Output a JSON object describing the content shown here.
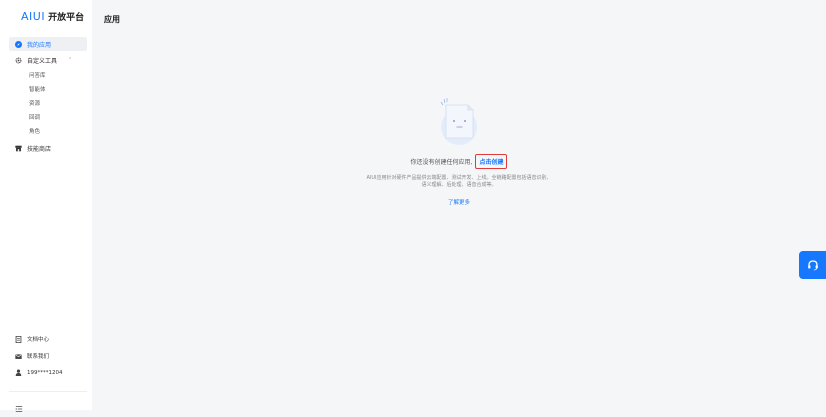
{
  "logo": {
    "brand": "AIUI",
    "rest": "开放平台"
  },
  "nav": {
    "my_apps": "我的应用",
    "custom_tools": "自定义工具",
    "sub_items": [
      "问答库",
      "智能体",
      "资源",
      "回调",
      "角色"
    ],
    "skill_store": "技能商店"
  },
  "bottom": {
    "docs": "文档中心",
    "contact": "联系我们",
    "user": "199****1204"
  },
  "main": {
    "title": "应用",
    "empty": {
      "line1": "你还没有创建任何应用,",
      "create_link": "点击创建",
      "desc": "AIUI应用针对硬件产品提供云端配置、测试开发、上线。全链路配置包括语音识别、语义理解、后处理、语音合成等。",
      "learn_more": "了解更多"
    }
  },
  "colors": {
    "accent": "#1677ff",
    "highlight_border": "#e03b3b"
  },
  "icons": {
    "my_apps": "compass-icon",
    "custom_tools": "gear-icon",
    "skill_store": "store-icon",
    "docs": "document-icon",
    "contact": "mail-icon",
    "user": "user-icon",
    "collapse": "menu-collapse-icon",
    "float": "headset-icon"
  }
}
